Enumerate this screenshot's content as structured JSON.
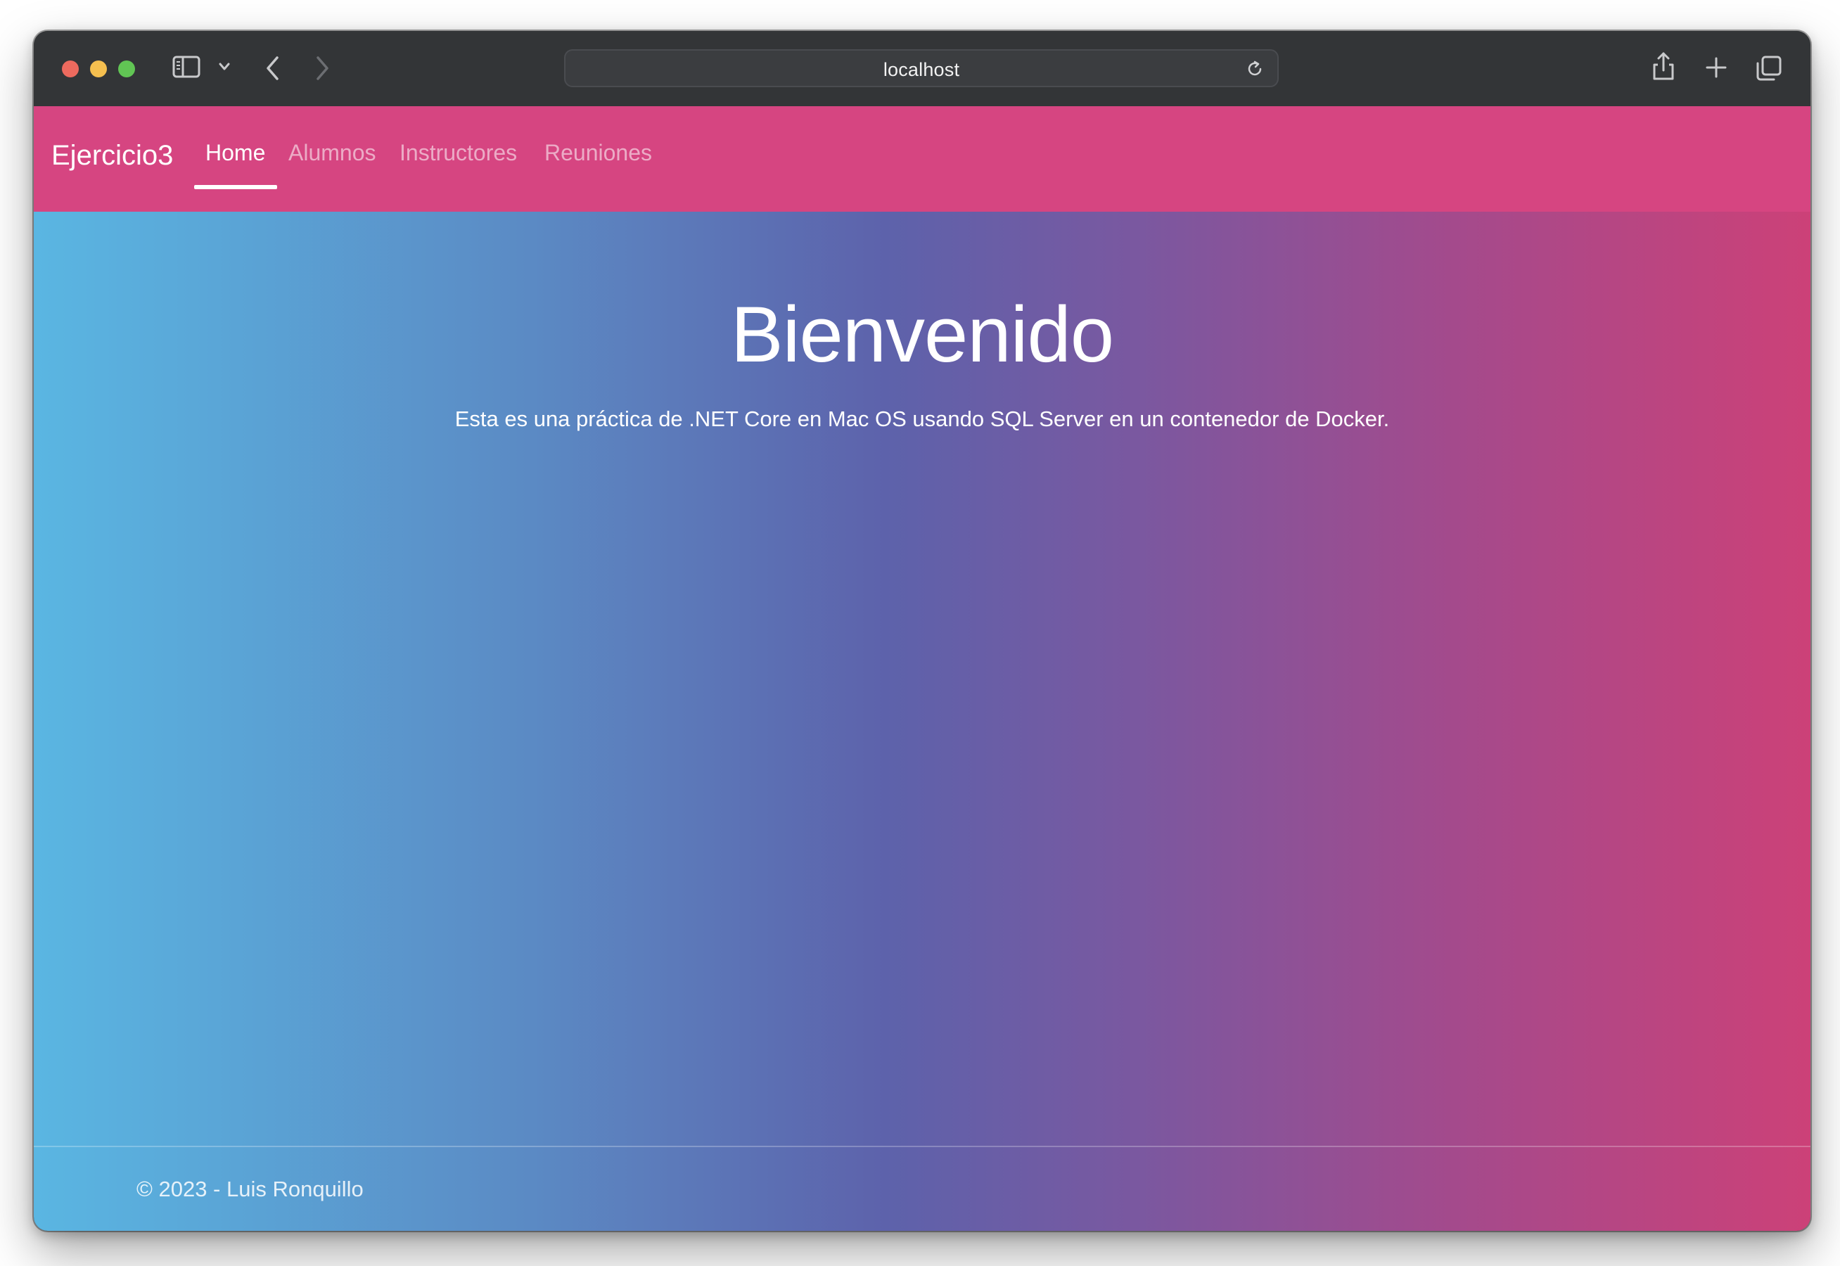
{
  "browser": {
    "url": "localhost",
    "traffic_colors": {
      "close": "#ed6a5e",
      "minimize": "#f5bf4f",
      "zoom": "#61c554"
    },
    "icons": {
      "sidebar": "sidebar-icon",
      "tab_menu": "chevron-down-icon",
      "back": "chevron-left-icon",
      "forward": "chevron-right-icon",
      "reload": "reload-icon",
      "share": "share-icon",
      "new_tab": "plus-icon",
      "tab_overview": "tabs-overview-icon"
    }
  },
  "navbar": {
    "brand": "Ejercicio3",
    "items": [
      {
        "label": "Home",
        "active": true
      },
      {
        "label": "Alumnos",
        "active": false
      },
      {
        "label": "Instructores",
        "active": false
      },
      {
        "label": "Reuniones",
        "active": false
      }
    ],
    "color": "#d64581"
  },
  "main": {
    "title": "Bienvenido",
    "subtitle": "Esta es una práctica de .NET Core en Mac OS usando SQL Server en un contenedor de Docker."
  },
  "footer": {
    "copyright_symbol": "©",
    "text": "2023 - Luis Ronquillo"
  }
}
